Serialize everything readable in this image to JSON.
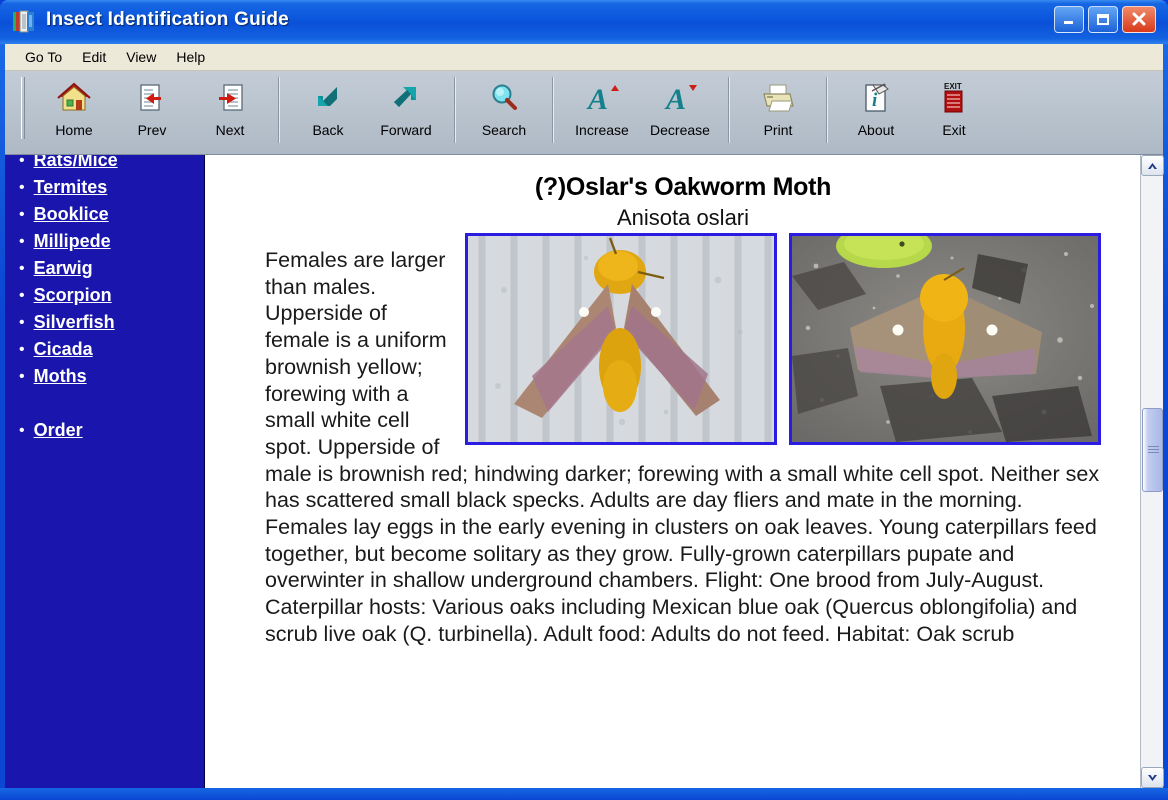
{
  "window": {
    "title": "Insect Identification Guide",
    "icon": "book-app-icon",
    "controls": {
      "minimize": "minimize-button",
      "maximize": "maximize-button",
      "close": "close-button"
    }
  },
  "menubar": {
    "items": [
      {
        "label": "Go To"
      },
      {
        "label": "Edit"
      },
      {
        "label": "View"
      },
      {
        "label": "Help"
      }
    ]
  },
  "toolbar": {
    "buttons": [
      {
        "label": "Home",
        "icon": "home-icon"
      },
      {
        "label": "Prev",
        "icon": "page-left-arrow-icon"
      },
      {
        "label": "Next",
        "icon": "page-right-arrow-icon"
      },
      {
        "label": "Back",
        "icon": "back-arrow-icon"
      },
      {
        "label": "Forward",
        "icon": "forward-arrow-icon"
      },
      {
        "label": "Search",
        "icon": "magnifier-icon"
      },
      {
        "label": "Increase",
        "icon": "font-increase-icon"
      },
      {
        "label": "Decrease",
        "icon": "font-decrease-icon"
      },
      {
        "label": "Print",
        "icon": "printer-icon"
      },
      {
        "label": "About",
        "icon": "info-page-icon"
      },
      {
        "label": "Exit",
        "icon": "exit-icon"
      }
    ]
  },
  "sidebar": {
    "background_color": "#1a15ad",
    "link_color": "#ffffff",
    "items": [
      {
        "label": "Rats/Mice"
      },
      {
        "label": "Termites"
      },
      {
        "label": "Booklice"
      },
      {
        "label": "Millipede"
      },
      {
        "label": "Earwig"
      },
      {
        "label": "Scorpion"
      },
      {
        "label": "Silverfish"
      },
      {
        "label": "Cicada"
      },
      {
        "label": "Moths"
      },
      {
        "label": "Order"
      }
    ]
  },
  "content": {
    "title": "(?)Oslar's Oakworm Moth",
    "subtitle": "Anisota oslari",
    "photos": [
      {
        "alt": "oslar-oakworm-moth-on-corrugated-metal",
        "border_color": "#2a1ce0"
      },
      {
        "alt": "oslar-oakworm-moth-on-asphalt-with-leaves",
        "border_color": "#2a1ce0"
      }
    ],
    "body": "Females are larger than males. Upperside of female is a uniform brownish yellow; forewing with a small white cell spot. Upperside of male is brownish red; hindwing darker; forewing with a small white cell spot. Neither sex has scattered small black specks. Adults are day fliers and mate in the morning. Females lay eggs in the early evening in clusters on oak leaves. Young caterpillars feed together, but become solitary as they grow. Fully-grown caterpillars pupate and overwinter in shallow underground chambers. Flight: One brood from July-August. Caterpillar hosts: Various oaks including Mexican blue oak (Quercus oblongifolia) and scrub live oak (Q. turbinella). Adult food: Adults do not feed. Habitat: Oak scrub"
  },
  "scrollbar": {
    "up_arrow": "scroll-up-arrow",
    "down_arrow": "scroll-down-arrow",
    "thumb": "scroll-thumb"
  }
}
